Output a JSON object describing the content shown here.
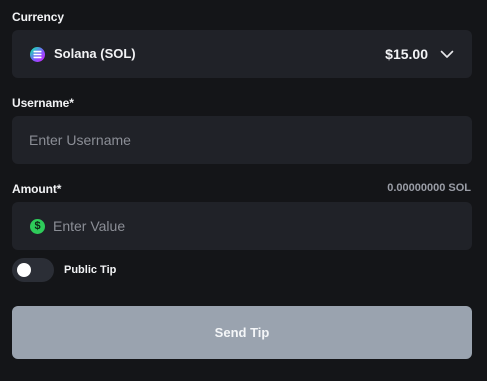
{
  "currency": {
    "label": "Currency",
    "selected_name": "Solana (SOL)",
    "selected_amount": "$15.00",
    "icon": "solana-icon"
  },
  "username": {
    "label": "Username*",
    "placeholder": "Enter Username",
    "value": ""
  },
  "amount": {
    "label": "Amount*",
    "balance": "0.00000000 SOL",
    "placeholder": "Enter Value",
    "value": "",
    "icon": "dollar-icon"
  },
  "public_tip": {
    "label": "Public Tip",
    "enabled": false
  },
  "submit": {
    "label": "Send Tip"
  },
  "colors": {
    "background": "#141518",
    "field": "#202228",
    "button_disabled": "#9aa3af",
    "dollar_icon": "#2ecb5a"
  }
}
